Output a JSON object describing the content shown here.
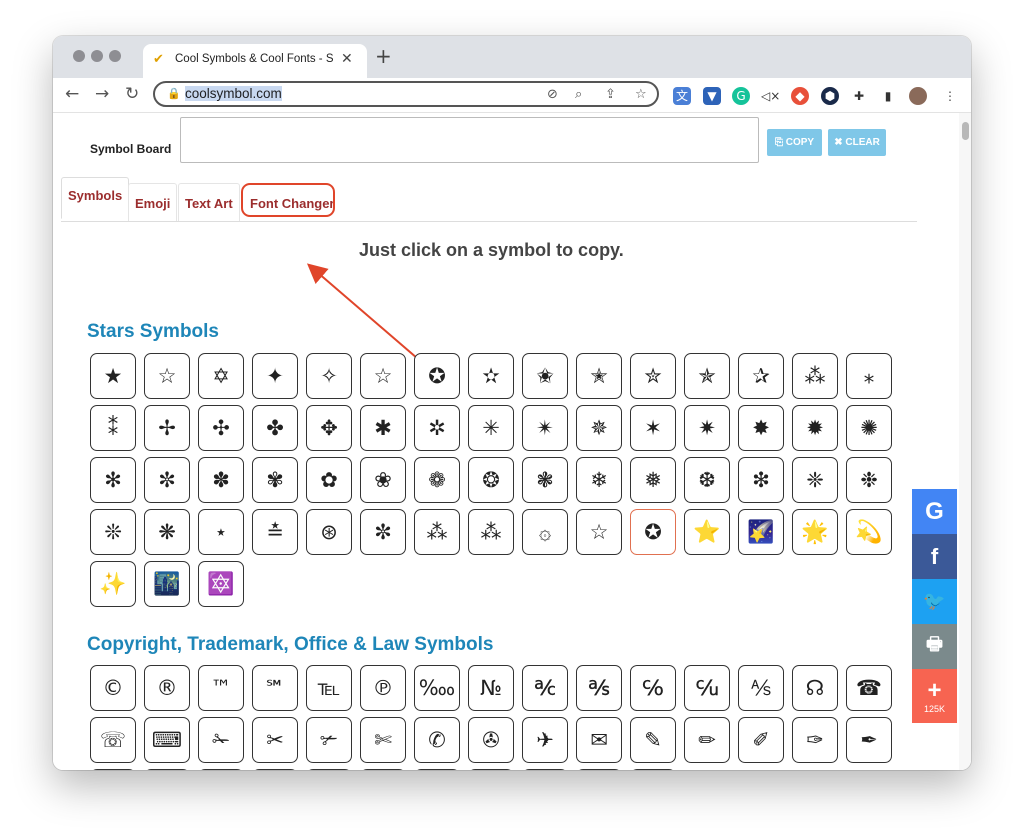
{
  "browser": {
    "tab_title": "Cool Symbols & Cool Fonts - S",
    "url": "coolsymbol.com"
  },
  "page": {
    "symbol_board_label": "Symbol Board",
    "copy_label": "COPY",
    "clear_label": "CLEAR",
    "tabs": [
      "Symbols",
      "Emoji",
      "Text Art",
      "Font Changer"
    ],
    "instruction": "Just click on a symbol to copy.",
    "sections": [
      {
        "title": "Stars Symbols",
        "symbols": [
          "★",
          "☆",
          "✡",
          "✦",
          "✧",
          "☆",
          "✪",
          "✫",
          "✬",
          "✭",
          "✮",
          "✯",
          "✰",
          "⁂",
          "⁎",
          "⁑",
          "✢",
          "✣",
          "✤",
          "✥",
          "✱",
          "✲",
          "✳",
          "✴",
          "✵",
          "✶",
          "✷",
          "✸",
          "✹",
          "✺",
          "✻",
          "✼",
          "✽",
          "✾",
          "✿",
          "❀",
          "❁",
          "❂",
          "❃",
          "❄",
          "❅",
          "❆",
          "❇",
          "❈",
          "❉",
          "❊",
          "❋",
          "⋆",
          "≛",
          "⊛",
          "✼",
          "⁂",
          "⁂",
          "۞",
          "☆",
          "✪",
          "⭐",
          "🌠",
          "🌟",
          "💫",
          "✨",
          "🌃",
          "🔯"
        ]
      },
      {
        "title": "Copyright, Trademark, Office & Law Symbols",
        "symbols": [
          "©",
          "®",
          "™",
          "℠",
          "℡",
          "℗",
          "‱",
          "№",
          "℀",
          "℁",
          "℅",
          "℆",
          "⅍",
          "☊",
          "☎",
          "☏",
          "⌨",
          "✁",
          "✂",
          "✃",
          "✄",
          "✆",
          "✇",
          "✈",
          "✉",
          "✎",
          "✏",
          "✐",
          "✑",
          "✒",
          "‰",
          "§",
          "¶",
          "✌",
          "☝",
          "☞",
          "☛",
          "☟",
          "☜",
          "☚",
          "✍"
        ]
      }
    ]
  },
  "share": {
    "google_label": "G",
    "facebook_label": "f",
    "twitter_label": "🐦",
    "print_label": "🖶",
    "plus_label": "+",
    "count": "125K"
  },
  "colors": {
    "accent_tab": "#9b2d2d",
    "section_title": "#1e86b8",
    "button": "#7fc7e8",
    "highlight": "#e0452a"
  }
}
